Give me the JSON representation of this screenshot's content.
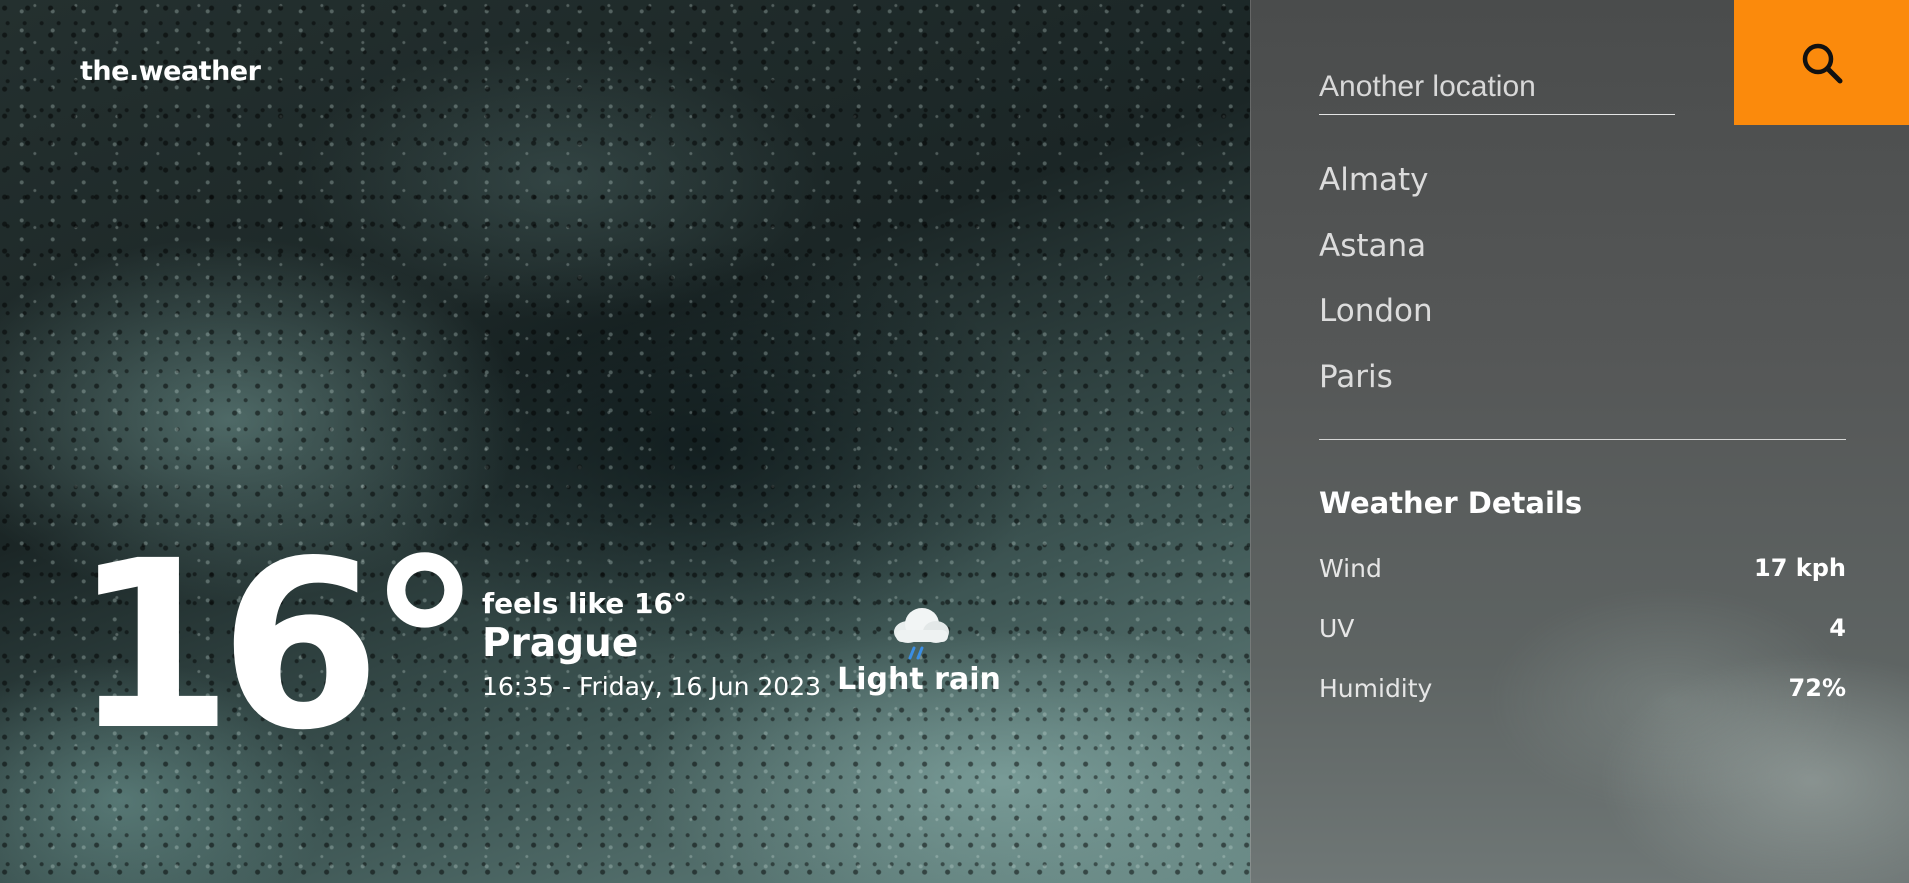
{
  "brand": "the.weather",
  "current": {
    "temperature": "16°",
    "feels_like": "feels like 16°",
    "city": "Prague",
    "datetime": "16:35 - Friday, 16 Jun 2023",
    "condition": "Light rain",
    "condition_icon": "rain-cloud-icon"
  },
  "search": {
    "placeholder": "Another location",
    "button_icon": "search-icon",
    "button_color": "#fb8a0c"
  },
  "locations": [
    "Almaty",
    "Astana",
    "London",
    "Paris"
  ],
  "details": {
    "title": "Weather Details",
    "rows": [
      {
        "label": "Wind",
        "value": "17 kph"
      },
      {
        "label": "UV",
        "value": "4"
      },
      {
        "label": "Humidity",
        "value": "72%"
      }
    ]
  }
}
